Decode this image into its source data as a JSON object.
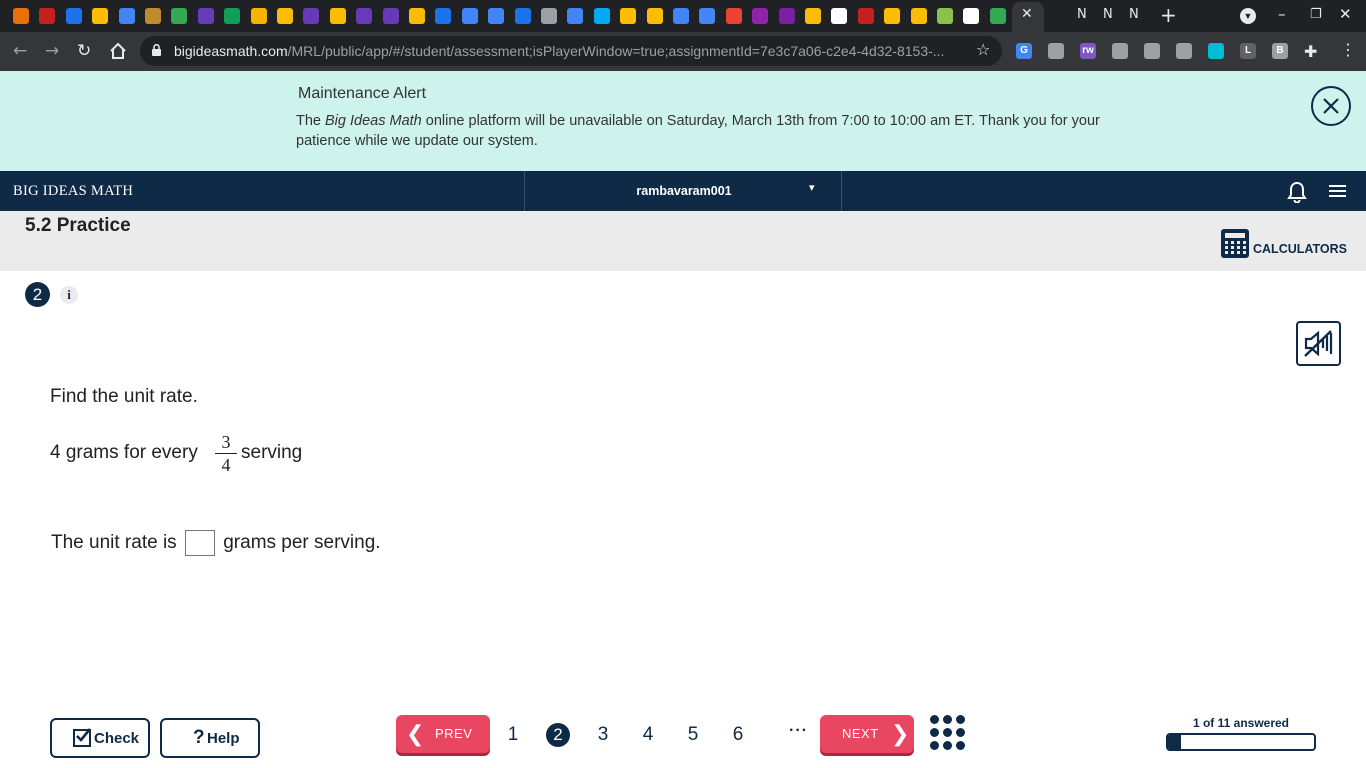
{
  "browser": {
    "tab_strip_favicons": [
      "#e8710a",
      "#c5221f",
      "#1a73e8",
      "#fbbc04",
      "#4285f4",
      "#c08a2b",
      "#34a853",
      "#673ab7",
      "#0f9d58",
      "#f4b400",
      "#fbbc04",
      "#673ab7",
      "#fbbc04",
      "#673ab7",
      "#673ab7",
      "#fbbc04",
      "#1a73e8",
      "#4285f4",
      "#4285f4",
      "#1a73e8",
      "#9aa0a6",
      "#4285f4",
      "#03a9f4",
      "#fbbc04",
      "#fbbc04",
      "#4285f4",
      "#4285f4",
      "#ea4335",
      "#8e24aa",
      "#7b1fa2",
      "#fbbc04",
      "#ffffff",
      "#c5221f",
      "#fbbc04",
      "#fbbc04",
      "#8bc34a",
      "#ffffff",
      "#34a853"
    ],
    "active_tab_close": "✕",
    "other_tabs": [
      "N",
      "N",
      "N"
    ],
    "url_host": "bigideasmath.com",
    "url_path": "/MRL/public/app/#/student/assessment;isPlayerWindow=true;assignmentId=7e3c7a06-c2e4-4d32-8153-...",
    "extensions": [
      {
        "label": "G",
        "color": "#4285f4"
      },
      {
        "label": "",
        "color": "#9aa0a6"
      },
      {
        "label": "rw",
        "color": "#7e57c2"
      },
      {
        "label": "",
        "color": "#9aa0a6"
      },
      {
        "label": "",
        "color": "#9aa0a6"
      },
      {
        "label": "",
        "color": "#9aa0a6"
      },
      {
        "label": "",
        "color": "#00bcd4"
      },
      {
        "label": "L",
        "color": "#5f6368"
      },
      {
        "label": "B",
        "color": "#9aa0a6"
      }
    ]
  },
  "alert": {
    "title": "Maintenance Alert",
    "body_pre": "The ",
    "body_em": "Big Ideas Math",
    "body_post": " online platform will be unavailable on Saturday, March 13th from 7:00 to 10:00 am ET. Thank you for your patience while we update our system."
  },
  "topnav": {
    "brand": "BIG IDEAS MATH",
    "username": "rambavaram001"
  },
  "assignment": {
    "title": "5.2 Practice",
    "calculators_label": "CALCULATORS"
  },
  "question": {
    "number": "2",
    "info_label": "i",
    "prompt": "Find the unit rate.",
    "rate_prefix": "4 grams for every",
    "fraction_numerator": "3",
    "fraction_denominator": "4",
    "rate_suffix": "serving",
    "answer_prefix": "The unit rate is",
    "answer_value": "",
    "answer_suffix": "grams per serving."
  },
  "footer": {
    "check_label": "Check",
    "help_label": "Help",
    "prev_label": "PREV",
    "next_label": "NEXT",
    "pages": [
      "1",
      "2",
      "3",
      "4",
      "5",
      "6"
    ],
    "current_page": "2",
    "more_pages": "···",
    "progress_label": "1 of 11 answered",
    "progress_fraction": 0.0909
  },
  "colors": {
    "navy": "#0e2a47",
    "alert_bg": "#cdf3ec",
    "nav_button": "#e84661"
  }
}
